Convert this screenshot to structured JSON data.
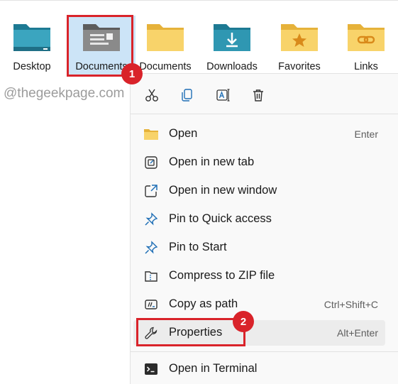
{
  "folders": [
    {
      "label": "Desktop",
      "icon": "desktop-folder-icon"
    },
    {
      "label": "Documents",
      "icon": "documents-folder-icon"
    },
    {
      "label": "Documents",
      "icon": "folder-icon"
    },
    {
      "label": "Downloads",
      "icon": "downloads-folder-icon"
    },
    {
      "label": "Favorites",
      "icon": "favorites-folder-icon"
    },
    {
      "label": "Links",
      "icon": "links-folder-icon"
    }
  ],
  "watermark": "@thegeekpage.com",
  "annotations": {
    "step1": "1",
    "step2": "2",
    "highlight_color": "#d9232a"
  },
  "quick_actions": [
    {
      "name": "cut",
      "icon": "scissors-icon"
    },
    {
      "name": "copy",
      "icon": "copy-icon"
    },
    {
      "name": "rename",
      "icon": "rename-icon"
    },
    {
      "name": "delete",
      "icon": "trash-icon"
    }
  ],
  "menu": {
    "items": [
      {
        "label": "Open",
        "shortcut": "Enter",
        "icon": "folder-open-icon"
      },
      {
        "label": "Open in new tab",
        "shortcut": "",
        "icon": "new-tab-icon"
      },
      {
        "label": "Open in new window",
        "shortcut": "",
        "icon": "new-window-icon"
      },
      {
        "label": "Pin to Quick access",
        "shortcut": "",
        "icon": "pin-icon"
      },
      {
        "label": "Pin to Start",
        "shortcut": "",
        "icon": "pin-icon"
      },
      {
        "label": "Compress to ZIP file",
        "shortcut": "",
        "icon": "zip-folder-icon"
      },
      {
        "label": "Copy as path",
        "shortcut": "Ctrl+Shift+C",
        "icon": "copy-path-icon"
      },
      {
        "label": "Properties",
        "shortcut": "Alt+Enter",
        "icon": "wrench-icon"
      },
      {
        "label": "Open in Terminal",
        "shortcut": "",
        "icon": "terminal-icon"
      }
    ]
  },
  "colors": {
    "accent": "#0f6ba8",
    "folder_yellow": "#f5c84c",
    "folder_teal": "#2f8fa6",
    "selection": "#cce4f7"
  }
}
